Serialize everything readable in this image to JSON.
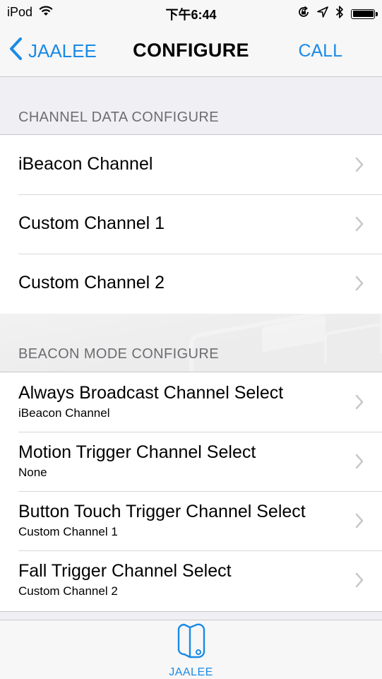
{
  "status_bar": {
    "carrier": "iPod",
    "time": "下午6:44",
    "battery_level": 1.0
  },
  "nav": {
    "back_label": "JAALEE",
    "title": "CONFIGURE",
    "action_label": "CALL"
  },
  "sections": [
    {
      "header": "CHANNEL DATA CONFIGURE",
      "rows": [
        {
          "label": "iBeacon Channel"
        },
        {
          "label": "Custom Channel 1"
        },
        {
          "label": "Custom Channel 2"
        }
      ]
    },
    {
      "header": "BEACON MODE CONFIGURE",
      "rows": [
        {
          "label": "Always Broadcast Channel Select",
          "value": "iBeacon Channel"
        },
        {
          "label": "Motion Trigger Channel Select",
          "value": "None"
        },
        {
          "label": "Button Touch Trigger Channel Select",
          "value": "Custom Channel 1"
        },
        {
          "label": "Fall Trigger Channel Select",
          "value": "Custom Channel 2"
        }
      ]
    }
  ],
  "tab_bar": {
    "items": [
      {
        "label": "JAALEE",
        "icon": "jaalee-tag-icon",
        "selected": true
      }
    ]
  },
  "colors": {
    "accent": "#1a8ae5",
    "background": "#efeff4",
    "separator": "#c8c7cc",
    "section_header_text": "#6d6d72"
  }
}
